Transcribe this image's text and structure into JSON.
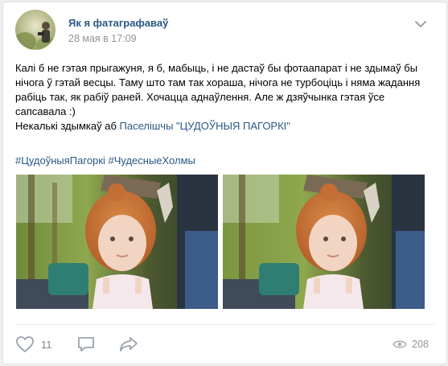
{
  "author": {
    "name": "Як я фатаграфаваў",
    "date": "28 мая в 17:09"
  },
  "post": {
    "paragraph": "Калі б не гэтая прыгажуня, я б, мабыць, і не дастаў бы фотаапарат і не здымаў бы нічога ў гэтай весцы. Таму што там так хораша, нічога не турбоціць і няма жадання рабіць так, як рабіў раней. Хочацца аднаўлення. Але ж дзяўчынка гэтая ўсе сапсавала :)",
    "line2_prefix": "Некалькі здымкаў аб ",
    "line2_link": "Паселішчы \"ЦУДОЎНЫЯ ПАГОРКІ\"",
    "hashtag1": "#ЦудоўныяПагоркі",
    "hashtag2": "#ЧудесныеХолмы"
  },
  "photos": [
    {
      "name": "photo-1",
      "icon": "photo-girl-red-hair"
    },
    {
      "name": "photo-2",
      "icon": "photo-girl-red-hair"
    }
  ],
  "footer": {
    "likes": "11",
    "views": "208"
  },
  "icons": {
    "like": "heart-icon",
    "comment": "comment-icon",
    "share": "share-icon",
    "views": "eye-icon",
    "menu": "chevron-down-icon"
  },
  "colors": {
    "link": "#2a5885",
    "muted": "#939393",
    "background": "#edeef0"
  }
}
